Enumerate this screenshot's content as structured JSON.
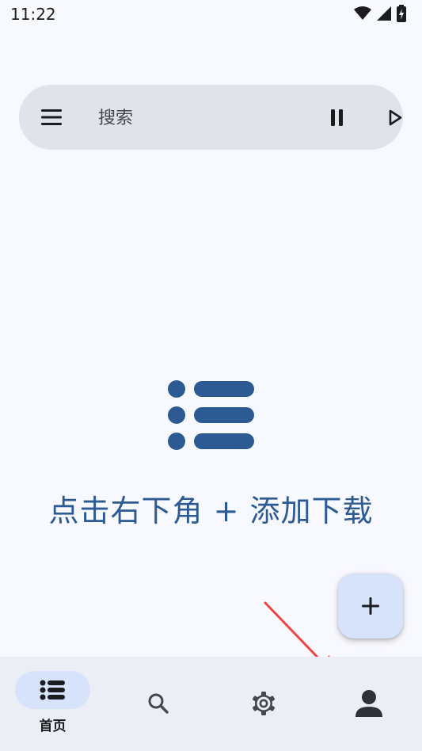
{
  "status": {
    "time": "11:22"
  },
  "search": {
    "placeholder": "搜索"
  },
  "icons": {
    "menu": "menu-icon",
    "pause": "pause-icon",
    "play": "play-icon",
    "empty": "list-icon",
    "add": "plus-icon",
    "home": "list-icon",
    "search": "search-icon",
    "settings": "gear-icon",
    "profile": "person-icon"
  },
  "empty_state": {
    "message": "点击右下角 + 添加下载"
  },
  "nav": {
    "items": [
      {
        "label": "首页",
        "active": true
      },
      {
        "label": "",
        "active": false
      },
      {
        "label": "",
        "active": false
      },
      {
        "label": "",
        "active": false
      }
    ]
  },
  "colors": {
    "accent": "#2c5a93",
    "background": "#f8f9fe",
    "search_bar": "#e1e3ea",
    "fab": "#d6e3fb",
    "annotation_arrow": "#ef4545"
  }
}
